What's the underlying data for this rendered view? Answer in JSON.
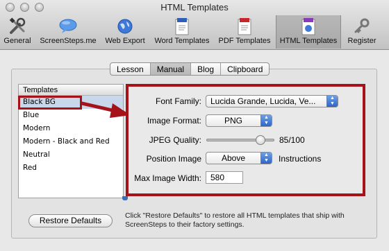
{
  "window": {
    "title": "HTML Templates"
  },
  "toolbar": {
    "items": [
      {
        "label": "General",
        "icon": "tools-icon"
      },
      {
        "label": "ScreenSteps.me",
        "icon": "speech-bubble-icon"
      },
      {
        "label": "Web Export",
        "icon": "globe-icon"
      },
      {
        "label": "Word Templates",
        "icon": "word-document-icon"
      },
      {
        "label": "PDF Templates",
        "icon": "pdf-document-icon"
      },
      {
        "label": "HTML Templates",
        "icon": "html-document-icon"
      },
      {
        "label": "Register",
        "icon": "key-icon"
      }
    ],
    "selected": "HTML Templates"
  },
  "tabs": {
    "items": [
      "Lesson",
      "Manual",
      "Blog",
      "Clipboard"
    ],
    "active": "Manual"
  },
  "templates": {
    "header": "Templates",
    "items": [
      "Black BG",
      "Blue",
      "Modern",
      "Modern - Black and Red",
      "Neutral",
      "Red"
    ],
    "selected": "Black BG"
  },
  "settings": {
    "font_family_label": "Font Family:",
    "font_family_value": "Lucida Grande, Lucida, Ve...",
    "image_format_label": "Image Format:",
    "image_format_value": "PNG",
    "jpeg_quality_label": "JPEG Quality:",
    "jpeg_quality_value": 85,
    "jpeg_quality_text": "85/100",
    "position_image_label": "Position Image",
    "position_image_value": "Above",
    "position_image_suffix": "Instructions",
    "max_width_label": "Max Image Width:",
    "max_width_value": "580"
  },
  "footer": {
    "restore_label": "Restore Defaults",
    "note": "Click \"Restore Defaults\" to restore all HTML templates that ship with ScreenSteps to their factory settings."
  },
  "colors": {
    "annotation_red": "#a5121a",
    "selection_blue": "#c9d7ea",
    "stepper_blue": "#2f64c8"
  }
}
